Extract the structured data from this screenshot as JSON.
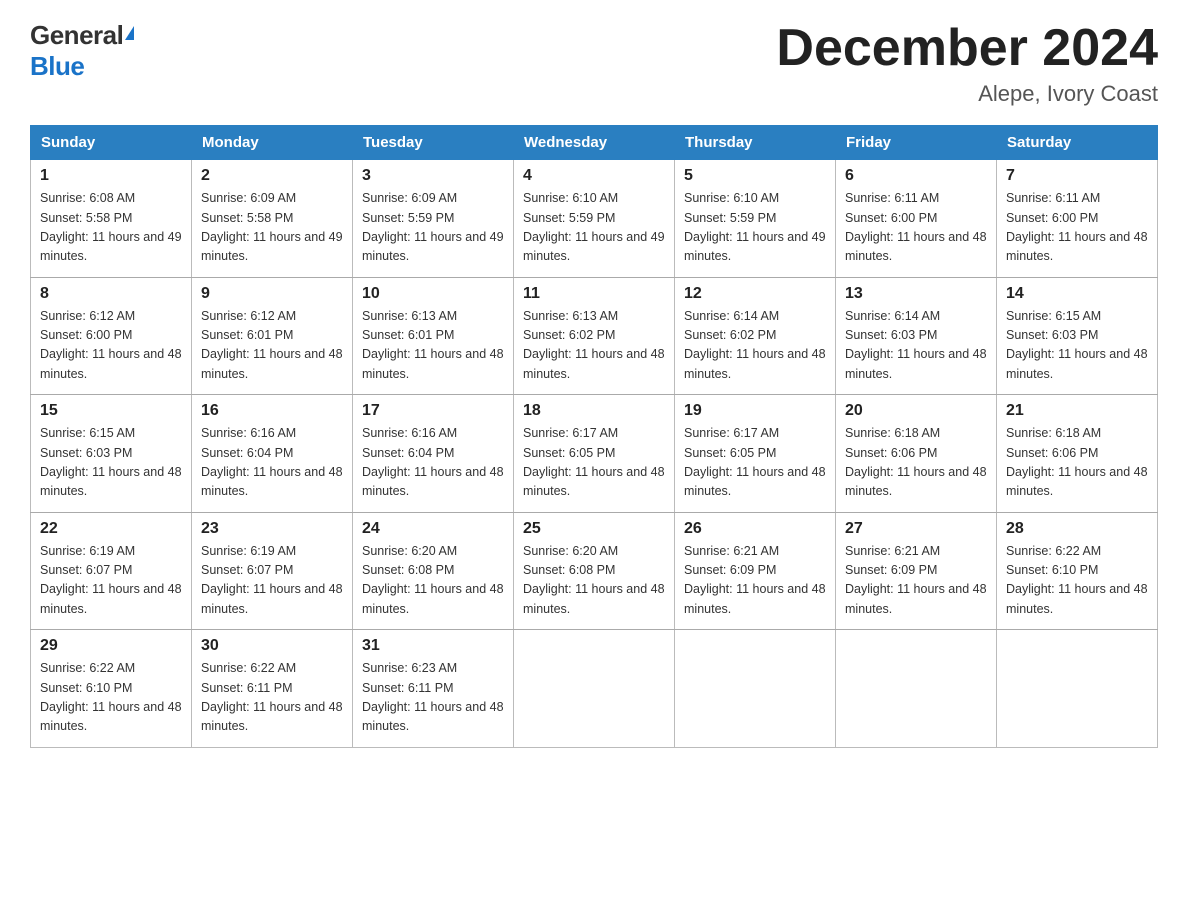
{
  "header": {
    "logo_general": "General",
    "logo_blue": "Blue",
    "month_title": "December 2024",
    "location": "Alepe, Ivory Coast"
  },
  "calendar": {
    "days_of_week": [
      "Sunday",
      "Monday",
      "Tuesday",
      "Wednesday",
      "Thursday",
      "Friday",
      "Saturday"
    ],
    "weeks": [
      [
        {
          "day": "1",
          "sunrise": "6:08 AM",
          "sunset": "5:58 PM",
          "daylight": "11 hours and 49 minutes."
        },
        {
          "day": "2",
          "sunrise": "6:09 AM",
          "sunset": "5:58 PM",
          "daylight": "11 hours and 49 minutes."
        },
        {
          "day": "3",
          "sunrise": "6:09 AM",
          "sunset": "5:59 PM",
          "daylight": "11 hours and 49 minutes."
        },
        {
          "day": "4",
          "sunrise": "6:10 AM",
          "sunset": "5:59 PM",
          "daylight": "11 hours and 49 minutes."
        },
        {
          "day": "5",
          "sunrise": "6:10 AM",
          "sunset": "5:59 PM",
          "daylight": "11 hours and 49 minutes."
        },
        {
          "day": "6",
          "sunrise": "6:11 AM",
          "sunset": "6:00 PM",
          "daylight": "11 hours and 48 minutes."
        },
        {
          "day": "7",
          "sunrise": "6:11 AM",
          "sunset": "6:00 PM",
          "daylight": "11 hours and 48 minutes."
        }
      ],
      [
        {
          "day": "8",
          "sunrise": "6:12 AM",
          "sunset": "6:00 PM",
          "daylight": "11 hours and 48 minutes."
        },
        {
          "day": "9",
          "sunrise": "6:12 AM",
          "sunset": "6:01 PM",
          "daylight": "11 hours and 48 minutes."
        },
        {
          "day": "10",
          "sunrise": "6:13 AM",
          "sunset": "6:01 PM",
          "daylight": "11 hours and 48 minutes."
        },
        {
          "day": "11",
          "sunrise": "6:13 AM",
          "sunset": "6:02 PM",
          "daylight": "11 hours and 48 minutes."
        },
        {
          "day": "12",
          "sunrise": "6:14 AM",
          "sunset": "6:02 PM",
          "daylight": "11 hours and 48 minutes."
        },
        {
          "day": "13",
          "sunrise": "6:14 AM",
          "sunset": "6:03 PM",
          "daylight": "11 hours and 48 minutes."
        },
        {
          "day": "14",
          "sunrise": "6:15 AM",
          "sunset": "6:03 PM",
          "daylight": "11 hours and 48 minutes."
        }
      ],
      [
        {
          "day": "15",
          "sunrise": "6:15 AM",
          "sunset": "6:03 PM",
          "daylight": "11 hours and 48 minutes."
        },
        {
          "day": "16",
          "sunrise": "6:16 AM",
          "sunset": "6:04 PM",
          "daylight": "11 hours and 48 minutes."
        },
        {
          "day": "17",
          "sunrise": "6:16 AM",
          "sunset": "6:04 PM",
          "daylight": "11 hours and 48 minutes."
        },
        {
          "day": "18",
          "sunrise": "6:17 AM",
          "sunset": "6:05 PM",
          "daylight": "11 hours and 48 minutes."
        },
        {
          "day": "19",
          "sunrise": "6:17 AM",
          "sunset": "6:05 PM",
          "daylight": "11 hours and 48 minutes."
        },
        {
          "day": "20",
          "sunrise": "6:18 AM",
          "sunset": "6:06 PM",
          "daylight": "11 hours and 48 minutes."
        },
        {
          "day": "21",
          "sunrise": "6:18 AM",
          "sunset": "6:06 PM",
          "daylight": "11 hours and 48 minutes."
        }
      ],
      [
        {
          "day": "22",
          "sunrise": "6:19 AM",
          "sunset": "6:07 PM",
          "daylight": "11 hours and 48 minutes."
        },
        {
          "day": "23",
          "sunrise": "6:19 AM",
          "sunset": "6:07 PM",
          "daylight": "11 hours and 48 minutes."
        },
        {
          "day": "24",
          "sunrise": "6:20 AM",
          "sunset": "6:08 PM",
          "daylight": "11 hours and 48 minutes."
        },
        {
          "day": "25",
          "sunrise": "6:20 AM",
          "sunset": "6:08 PM",
          "daylight": "11 hours and 48 minutes."
        },
        {
          "day": "26",
          "sunrise": "6:21 AM",
          "sunset": "6:09 PM",
          "daylight": "11 hours and 48 minutes."
        },
        {
          "day": "27",
          "sunrise": "6:21 AM",
          "sunset": "6:09 PM",
          "daylight": "11 hours and 48 minutes."
        },
        {
          "day": "28",
          "sunrise": "6:22 AM",
          "sunset": "6:10 PM",
          "daylight": "11 hours and 48 minutes."
        }
      ],
      [
        {
          "day": "29",
          "sunrise": "6:22 AM",
          "sunset": "6:10 PM",
          "daylight": "11 hours and 48 minutes."
        },
        {
          "day": "30",
          "sunrise": "6:22 AM",
          "sunset": "6:11 PM",
          "daylight": "11 hours and 48 minutes."
        },
        {
          "day": "31",
          "sunrise": "6:23 AM",
          "sunset": "6:11 PM",
          "daylight": "11 hours and 48 minutes."
        },
        null,
        null,
        null,
        null
      ]
    ]
  }
}
